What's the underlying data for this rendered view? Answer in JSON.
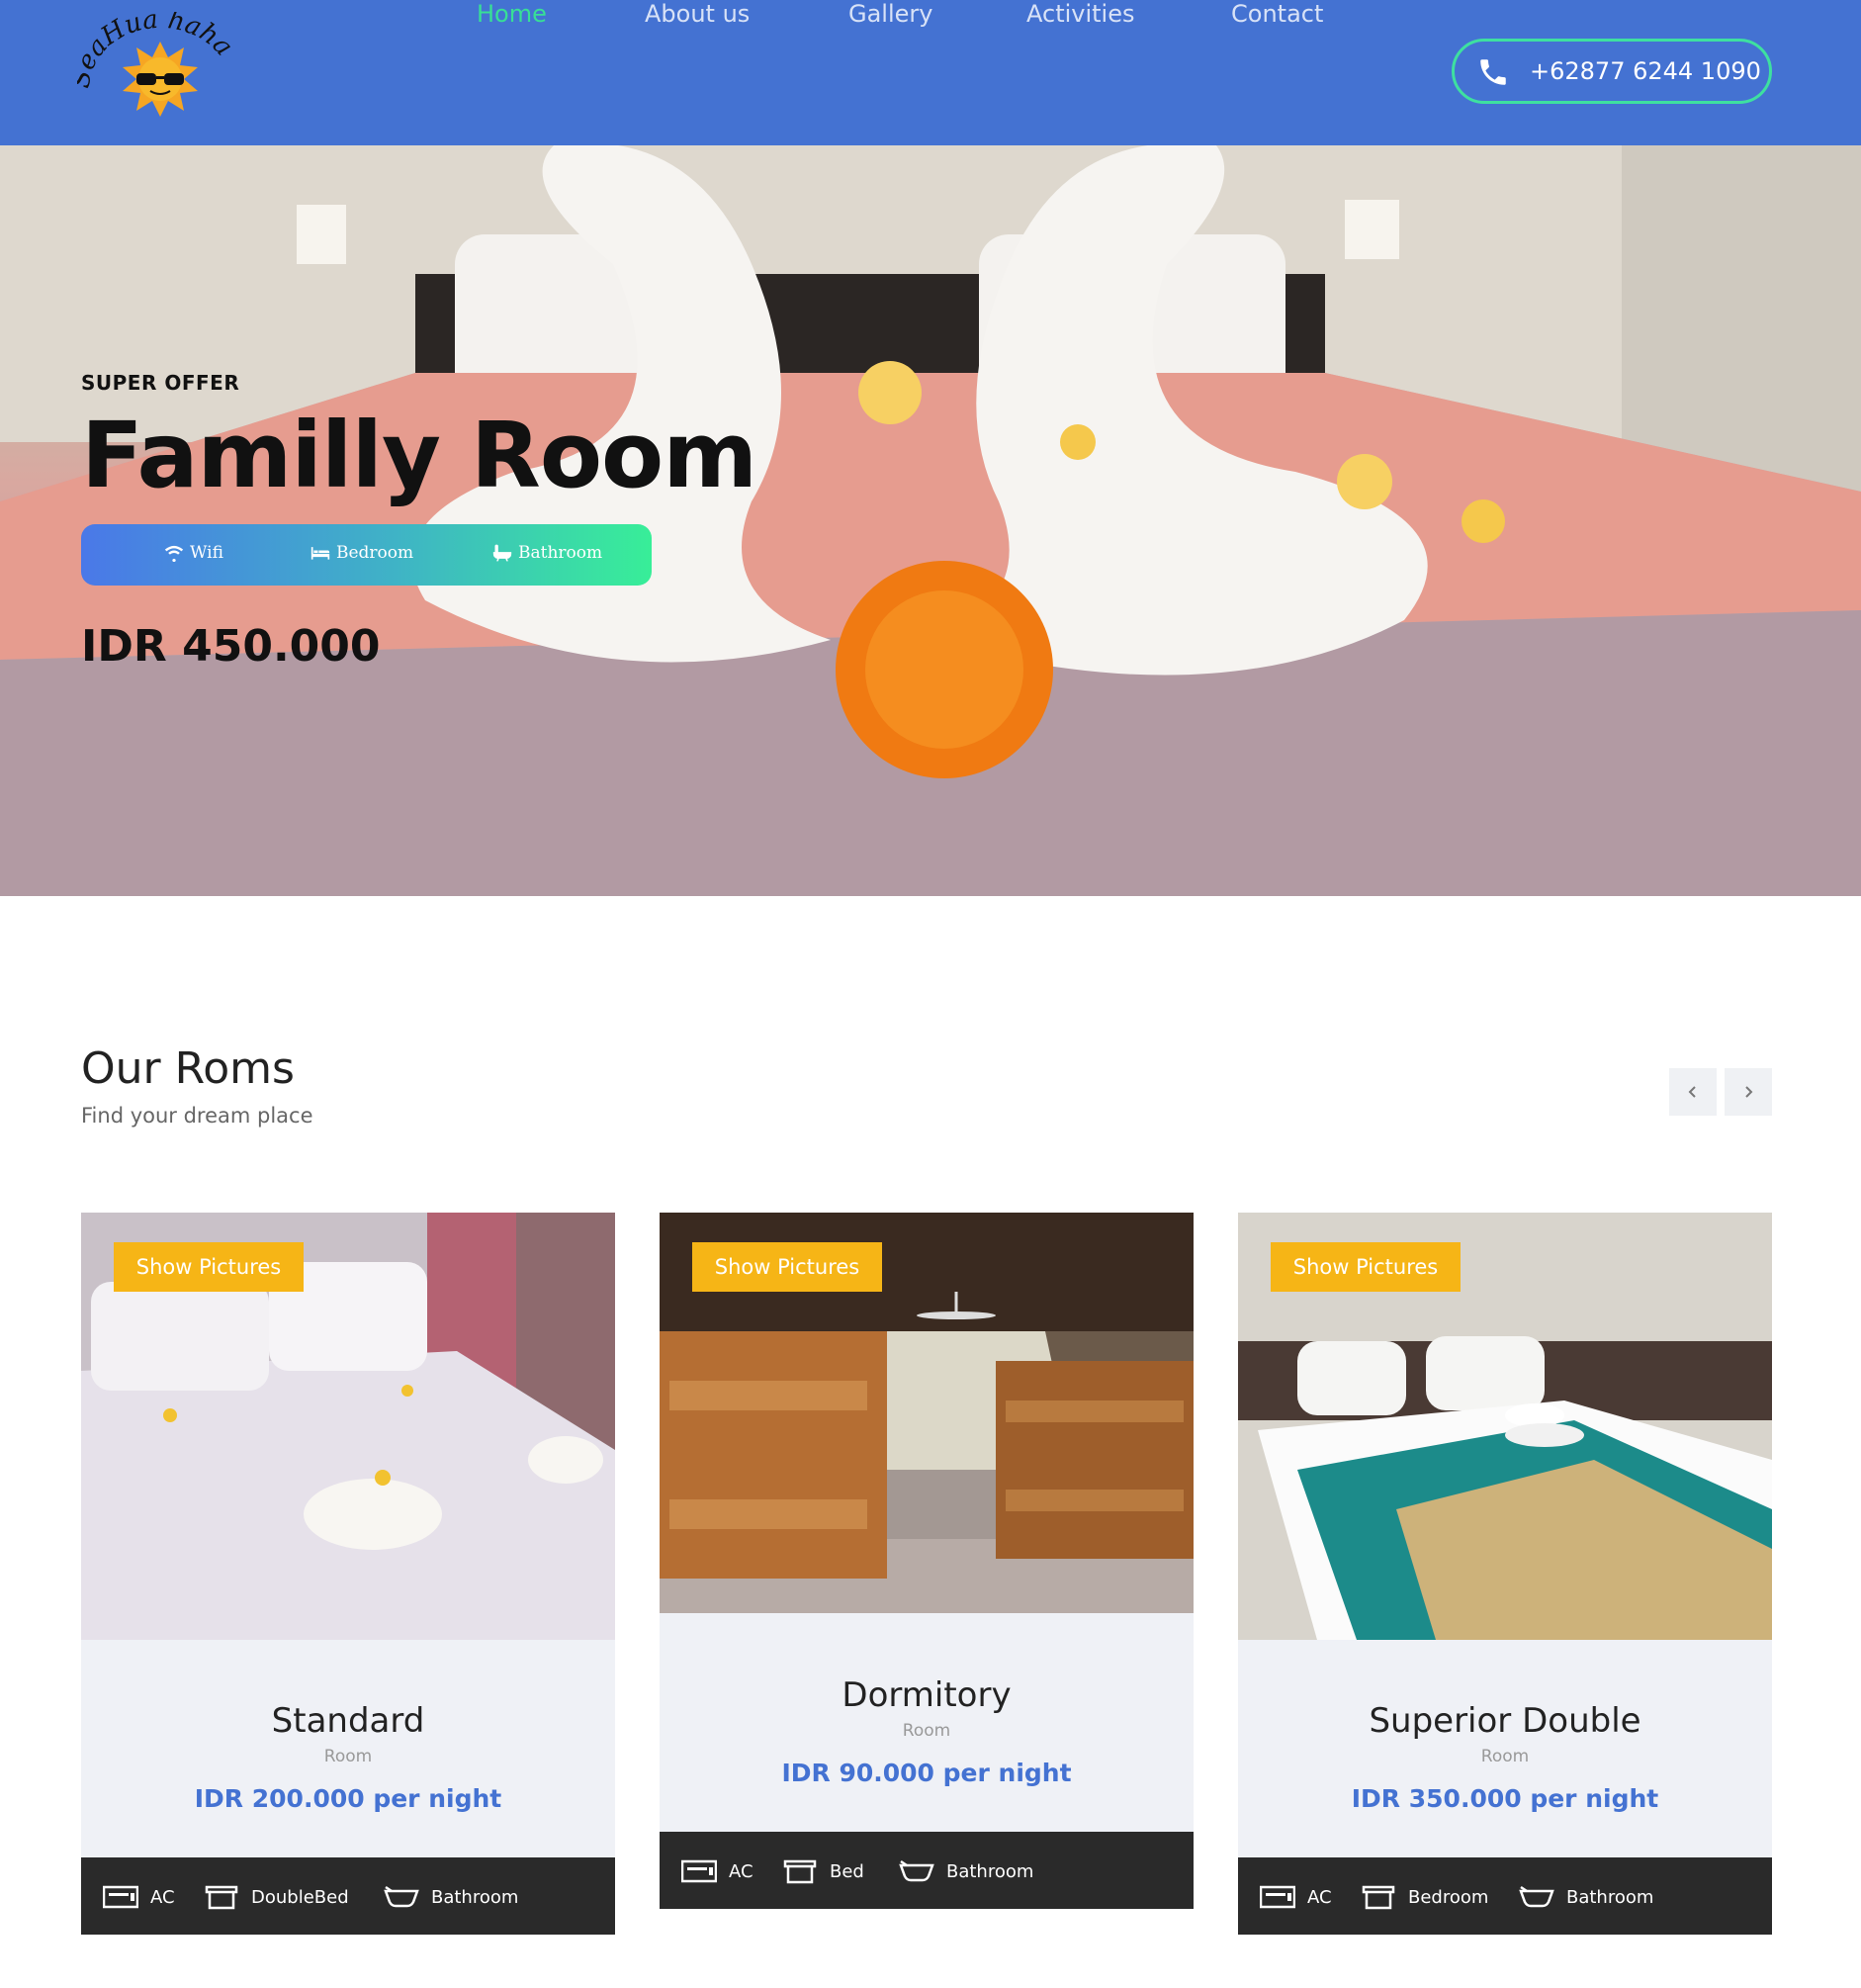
{
  "brand": {
    "logo_text": "SeaHua haha"
  },
  "nav": {
    "items": [
      {
        "label": "Home",
        "active": true
      },
      {
        "label": "About us",
        "active": false
      },
      {
        "label": "Gallery",
        "active": false
      },
      {
        "label": "Activities",
        "active": false
      },
      {
        "label": "Contact",
        "active": false
      }
    ],
    "phone": "+62877 6244 1090"
  },
  "hero": {
    "kicker": "SUPER OFFER",
    "title": "Familly Room",
    "amenities": [
      "Wifi",
      "Bedroom",
      "Bathroom"
    ],
    "price": "IDR 450.000"
  },
  "rooms_section": {
    "title": "Our Roms",
    "subtitle": "Find your dream place"
  },
  "rooms": [
    {
      "button": "Show Pictures",
      "name": "Standard",
      "type": "Room",
      "price": "IDR 200.000 per night",
      "features": [
        "AC",
        "DoubleBed",
        "Bathroom"
      ]
    },
    {
      "button": "Show Pictures",
      "name": "Dormitory",
      "type": "Room",
      "price": "IDR 90.000 per night",
      "features": [
        "AC",
        "Bed",
        "Bathroom"
      ]
    },
    {
      "button": "Show Pictures",
      "name": "Superior Double",
      "type": "Room",
      "price": "IDR 350.000 per night",
      "features": [
        "AC",
        "Bedroom",
        "Bathroom"
      ]
    }
  ],
  "colors": {
    "header_bg": "#4472d2",
    "nav_active": "#38df96",
    "accent_yellow": "#f6b516",
    "price_blue": "#4472d2",
    "card_footer": "#2a2a2a"
  },
  "icons": [
    "phone-icon",
    "wifi-icon",
    "bed-icon",
    "bathtub-icon",
    "chevron-left-icon",
    "chevron-right-icon",
    "ac-icon",
    "bed-frame-icon"
  ]
}
